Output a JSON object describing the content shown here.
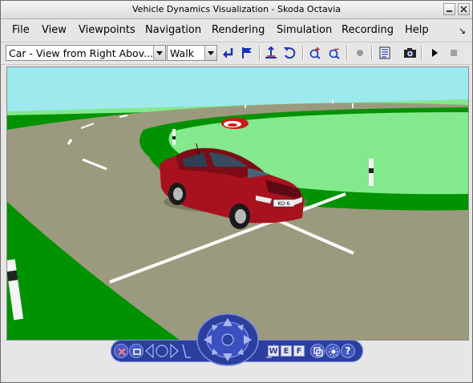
{
  "window": {
    "title": "Vehicle Dynamics Visualization - Skoda Octavia"
  },
  "menubar": {
    "items": [
      {
        "label": "File"
      },
      {
        "label": "View"
      },
      {
        "label": "Viewpoints"
      },
      {
        "label": "Navigation"
      },
      {
        "label": "Rendering"
      },
      {
        "label": "Simulation"
      },
      {
        "label": "Recording"
      },
      {
        "label": "Help"
      }
    ],
    "whats_this": "↘"
  },
  "toolbar": {
    "viewpoint_select": "Car - View from Right Abov...",
    "nav_mode_select": "Walk"
  },
  "scene": {
    "license_plate": "KO·6"
  },
  "navbar": {
    "walk": "W",
    "examine": "E",
    "fly": "F",
    "help": "?"
  },
  "colors": {
    "sky": "#9de9ee",
    "grass": "#009200",
    "road": "#9b9a7e",
    "car": "#a8121e",
    "nav_blue": "#2c3f9e"
  }
}
